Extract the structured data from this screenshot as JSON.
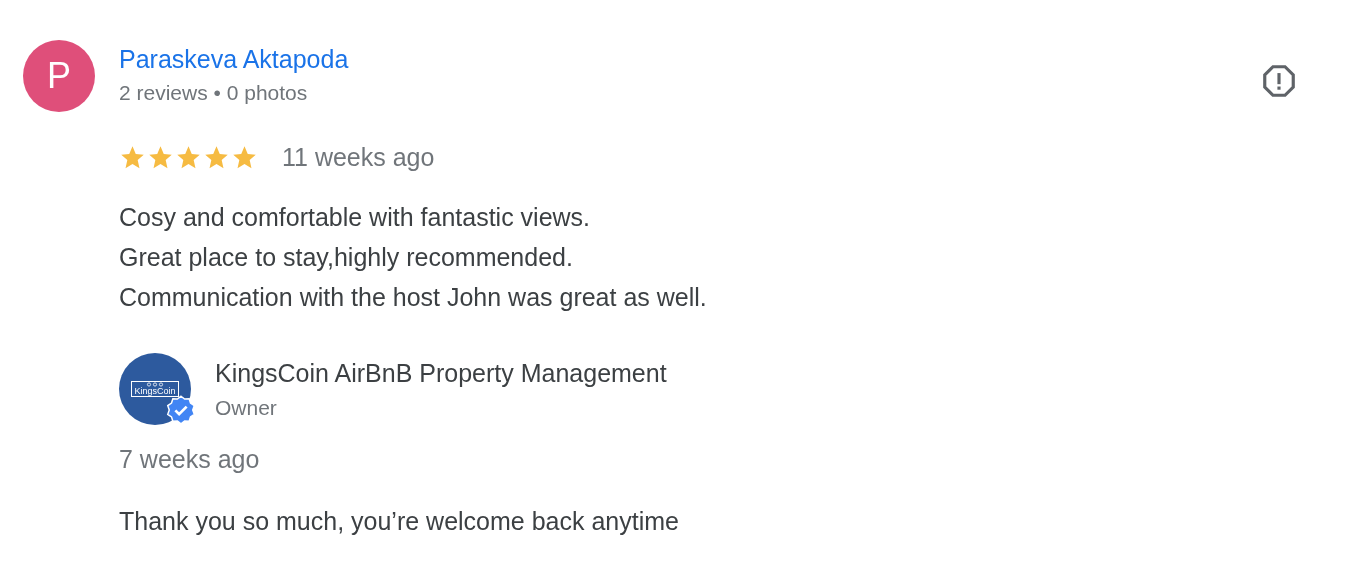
{
  "review": {
    "avatar_letter": "P",
    "author": "Paraskeva Aktapoda",
    "meta": "2 reviews • 0 photos",
    "stars": 5,
    "time": "11 weeks ago",
    "lines": [
      "Cosy and comfortable with fantastic views.",
      "Great place to stay,highly recommended.",
      "Communication with the host John was great as well."
    ]
  },
  "reply": {
    "logo_text": "KingsCoin",
    "verified": true,
    "name": "KingsCoin AirBnB Property Management",
    "role": "Owner",
    "time": "7 weeks ago",
    "text": "Thank you so much, you’re welcome back anytime"
  }
}
